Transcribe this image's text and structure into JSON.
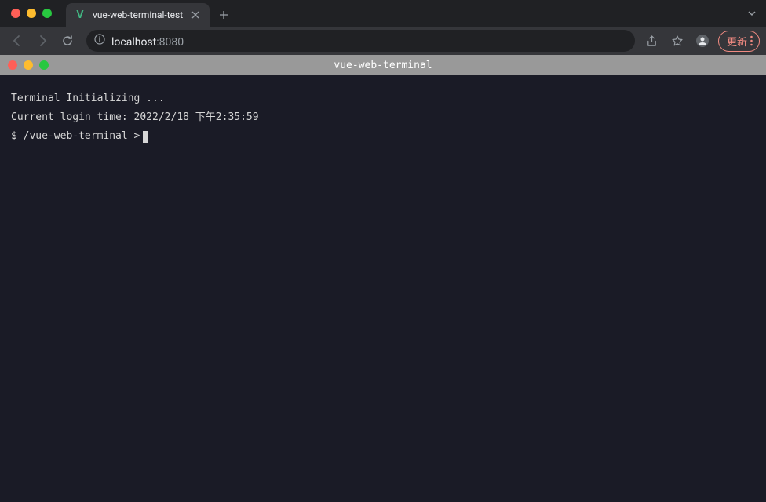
{
  "browser": {
    "tab": {
      "favicon_letter": "V",
      "title": "vue-web-terminal-test"
    },
    "address": {
      "host": "localhost",
      "port": ":8080"
    },
    "update_label": "更新"
  },
  "terminal": {
    "title": "vue-web-terminal",
    "lines": [
      "Terminal Initializing ...",
      "Current login time: 2022/2/18 下午2:35:59"
    ],
    "prompt": "$ /vue-web-terminal > "
  }
}
